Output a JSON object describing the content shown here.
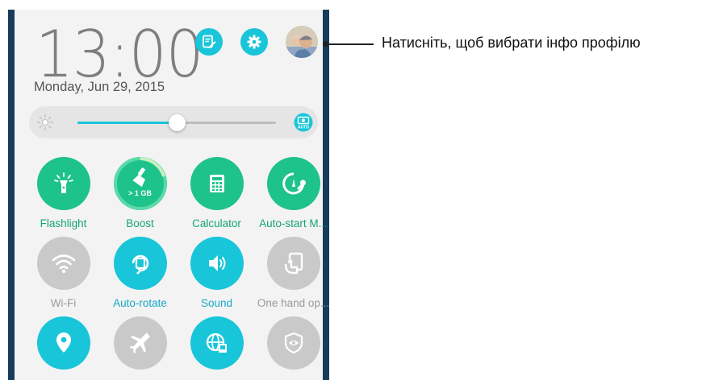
{
  "header": {
    "time": "13:00",
    "date": "Monday, Jun 29, 2015",
    "icons": [
      "notepad-icon",
      "gear-icon"
    ],
    "avatar": "profile-avatar"
  },
  "brightness": {
    "level_percent": 50,
    "auto_label": "AUTO"
  },
  "tiles": [
    {
      "label": "Flashlight",
      "icon": "flashlight-icon",
      "state": "on"
    },
    {
      "label": "Boost",
      "icon": "boost-broom-icon",
      "state": "on",
      "badge": "> 1 GB"
    },
    {
      "label": "Calculator",
      "icon": "calculator-icon",
      "state": "on"
    },
    {
      "label": "Auto-start M...",
      "icon": "auto-start-manager-icon",
      "state": "on"
    },
    {
      "label": "Wi-Fi",
      "icon": "wifi-icon",
      "state": "off"
    },
    {
      "label": "Auto-rotate",
      "icon": "auto-rotate-icon",
      "state": "blue"
    },
    {
      "label": "Sound",
      "icon": "sound-icon",
      "state": "blue"
    },
    {
      "label": "One hand op...",
      "icon": "one-hand-icon",
      "state": "off"
    },
    {
      "label": "",
      "icon": "location-icon",
      "state": "blue"
    },
    {
      "label": "",
      "icon": "airplane-icon",
      "state": "off"
    },
    {
      "label": "",
      "icon": "network-globe-icon",
      "state": "blue"
    },
    {
      "label": "",
      "icon": "eye-shield-icon",
      "state": "off"
    }
  ],
  "colors": {
    "teal": "#1ec28b",
    "cyan": "#19c5d9",
    "inactive": "#c9c9c9",
    "frame": "#173c5c"
  },
  "callout": {
    "text": "Натисніть, щоб вибрати інфо профілю"
  }
}
